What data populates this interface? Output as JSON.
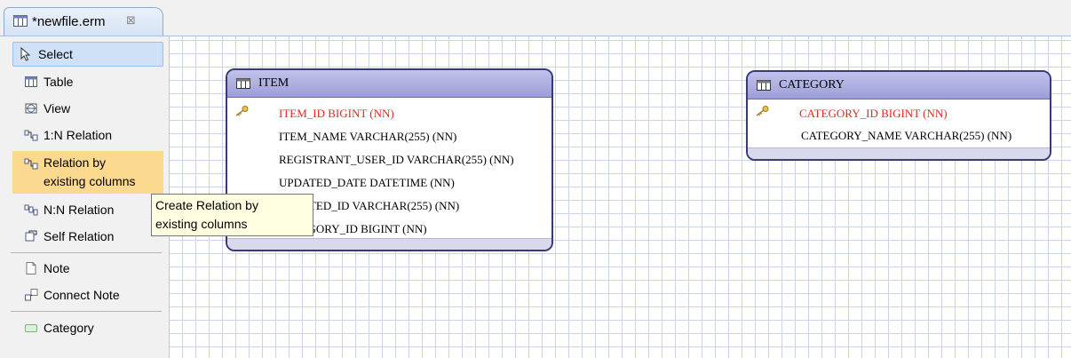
{
  "editor": {
    "tab_title": "*newfile.erm",
    "tab_close": "⊠"
  },
  "palette": {
    "items": [
      {
        "label": "Select",
        "icon": "arrow-cursor-icon"
      },
      {
        "label": "Table",
        "icon": "table-icon"
      },
      {
        "label": "View",
        "icon": "view-icon"
      },
      {
        "label": "1:N Relation",
        "icon": "one-to-many-relation-icon"
      },
      {
        "label": "Relation by existing columns",
        "label_line1": "Relation by",
        "label_line2": "existing columns",
        "icon": "relation-existing-columns-icon"
      },
      {
        "label": "N:N Relation",
        "icon": "many-to-many-relation-icon"
      },
      {
        "label": "Self Relation",
        "icon": "self-relation-icon"
      },
      {
        "label": "Note",
        "icon": "note-icon"
      },
      {
        "label": "Connect Note",
        "icon": "connect-note-icon"
      },
      {
        "label": "Category",
        "icon": "category-icon"
      }
    ]
  },
  "tooltip": {
    "line1": "Create Relation by",
    "line2": "existing columns"
  },
  "tables": [
    {
      "name": "ITEM",
      "columns": [
        {
          "text": "ITEM_ID BIGINT (NN)",
          "primary_key": true
        },
        {
          "text": "ITEM_NAME VARCHAR(255) (NN)",
          "primary_key": false
        },
        {
          "text": "REGISTRANT_USER_ID VARCHAR(255) (NN)",
          "primary_key": false
        },
        {
          "text": "UPDATED_DATE DATETIME (NN)",
          "primary_key": false
        },
        {
          "text": "UPDATED_ID VARCHAR(255) (NN)",
          "primary_key": false
        },
        {
          "text": "CATEGORY_ID BIGINT (NN)",
          "primary_key": false
        }
      ]
    },
    {
      "name": "CATEGORY",
      "columns": [
        {
          "text": "CATEGORY_ID BIGINT (NN)",
          "primary_key": true
        },
        {
          "text": "CATEGORY_NAME VARCHAR(255) (NN)",
          "primary_key": false
        }
      ]
    }
  ],
  "colors": {
    "primary_key_text": "#e8271f",
    "table_header": "#a9a9df",
    "table_border": "#3a3a78",
    "palette_selected": "#cfe1f7",
    "palette_hover": "#fbd98f",
    "tooltip_bg": "#ffffe1",
    "grid": "#c9d4ea"
  }
}
